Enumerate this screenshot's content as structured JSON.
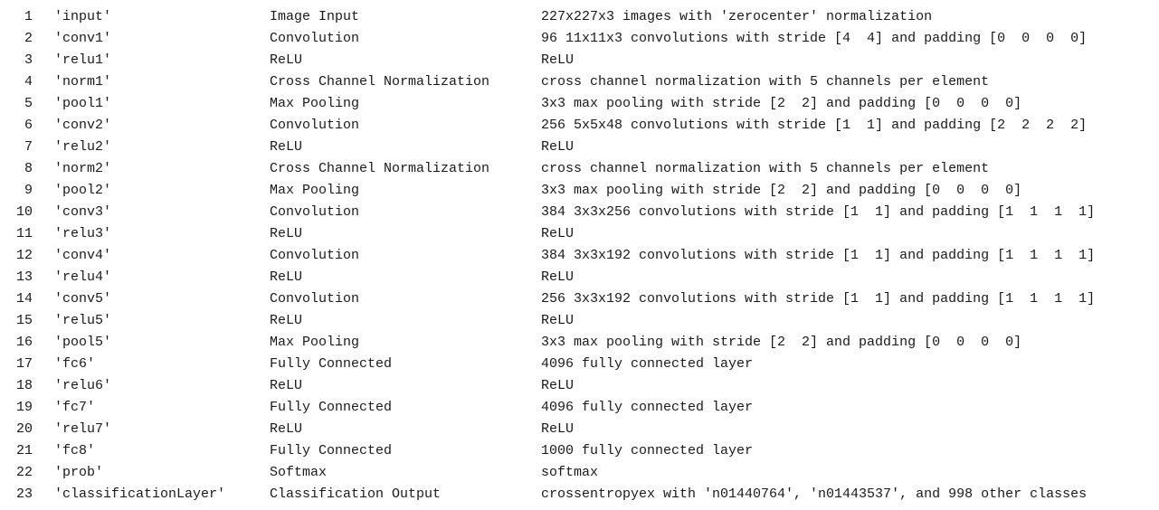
{
  "layers": [
    {
      "index": "1",
      "name": "'input'",
      "type": "Image Input",
      "description": "227x227x3 images with 'zerocenter' normalization"
    },
    {
      "index": "2",
      "name": "'conv1'",
      "type": "Convolution",
      "description": "96 11x11x3 convolutions with stride [4  4] and padding [0  0  0  0]"
    },
    {
      "index": "3",
      "name": "'relu1'",
      "type": "ReLU",
      "description": "ReLU"
    },
    {
      "index": "4",
      "name": "'norm1'",
      "type": "Cross Channel Normalization",
      "description": "cross channel normalization with 5 channels per element"
    },
    {
      "index": "5",
      "name": "'pool1'",
      "type": "Max Pooling",
      "description": "3x3 max pooling with stride [2  2] and padding [0  0  0  0]"
    },
    {
      "index": "6",
      "name": "'conv2'",
      "type": "Convolution",
      "description": "256 5x5x48 convolutions with stride [1  1] and padding [2  2  2  2]"
    },
    {
      "index": "7",
      "name": "'relu2'",
      "type": "ReLU",
      "description": "ReLU"
    },
    {
      "index": "8",
      "name": "'norm2'",
      "type": "Cross Channel Normalization",
      "description": "cross channel normalization with 5 channels per element"
    },
    {
      "index": "9",
      "name": "'pool2'",
      "type": "Max Pooling",
      "description": "3x3 max pooling with stride [2  2] and padding [0  0  0  0]"
    },
    {
      "index": "10",
      "name": "'conv3'",
      "type": "Convolution",
      "description": "384 3x3x256 convolutions with stride [1  1] and padding [1  1  1  1]"
    },
    {
      "index": "11",
      "name": "'relu3'",
      "type": "ReLU",
      "description": "ReLU"
    },
    {
      "index": "12",
      "name": "'conv4'",
      "type": "Convolution",
      "description": "384 3x3x192 convolutions with stride [1  1] and padding [1  1  1  1]"
    },
    {
      "index": "13",
      "name": "'relu4'",
      "type": "ReLU",
      "description": "ReLU"
    },
    {
      "index": "14",
      "name": "'conv5'",
      "type": "Convolution",
      "description": "256 3x3x192 convolutions with stride [1  1] and padding [1  1  1  1]"
    },
    {
      "index": "15",
      "name": "'relu5'",
      "type": "ReLU",
      "description": "ReLU"
    },
    {
      "index": "16",
      "name": "'pool5'",
      "type": "Max Pooling",
      "description": "3x3 max pooling with stride [2  2] and padding [0  0  0  0]"
    },
    {
      "index": "17",
      "name": "'fc6'",
      "type": "Fully Connected",
      "description": "4096 fully connected layer"
    },
    {
      "index": "18",
      "name": "'relu6'",
      "type": "ReLU",
      "description": "ReLU"
    },
    {
      "index": "19",
      "name": "'fc7'",
      "type": "Fully Connected",
      "description": "4096 fully connected layer"
    },
    {
      "index": "20",
      "name": "'relu7'",
      "type": "ReLU",
      "description": "ReLU"
    },
    {
      "index": "21",
      "name": "'fc8'",
      "type": "Fully Connected",
      "description": "1000 fully connected layer"
    },
    {
      "index": "22",
      "name": "'prob'",
      "type": "Softmax",
      "description": "softmax"
    },
    {
      "index": "23",
      "name": "'classificationLayer'",
      "type": "Classification Output",
      "description": "crossentropyex with 'n01440764', 'n01443537', and 998 other classes"
    }
  ]
}
